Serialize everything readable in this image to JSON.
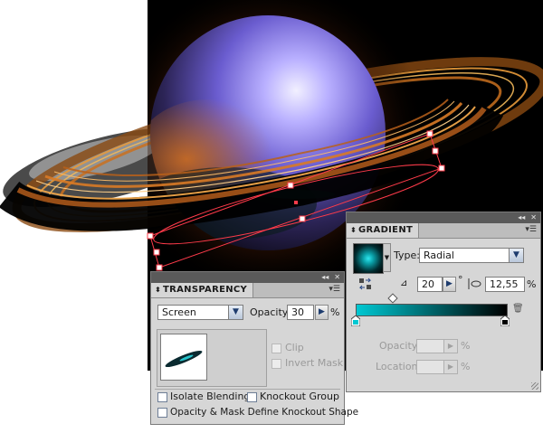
{
  "transparency": {
    "tab_label": "TRANSPARENCY",
    "blend_mode": "Screen",
    "opacity_label": "Opacity:",
    "opacity_value": "30",
    "opacity_unit": "%",
    "clip_label": "Clip",
    "invert_mask_label": "Invert Mask",
    "isolate_blending_label": "Isolate Blending",
    "knockout_group_label": "Knockout Group",
    "opacity_mask_knockout_label": "Opacity & Mask Define Knockout Shape",
    "dropdown_glyph": "▼",
    "arrow_glyph": "▶",
    "menu_glyph": "▾☰",
    "collapse_glyph": "◂◂",
    "close_glyph": "✕",
    "tab_marker": "⬍"
  },
  "gradient": {
    "tab_label": "GRADIENT",
    "type_label": "Type:",
    "type_value": "Radial",
    "angle_value": "20",
    "angle_unit": "°",
    "aspect_value": "12,55",
    "aspect_unit": "%",
    "opacity_label": "Opacity:",
    "opacity_unit": "%",
    "location_label": "Location:",
    "location_unit": "%",
    "stop_colors": [
      "#00c8d2",
      "#000000"
    ],
    "dropdown_glyph": "▼",
    "arrow_glyph": "▶",
    "menu_glyph": "▾☰",
    "collapse_glyph": "◂◂",
    "close_glyph": "✕",
    "tab_marker": "⬍",
    "trash_glyph": "🗑",
    "angle_glyph": "⊿"
  },
  "colors": {
    "canvas_bg": "#000000",
    "planet_highlight": "#d9d6ff",
    "planet_body": "#7a6bd8",
    "ring_orange": "#e08a2a",
    "selection": "#ff3b4a"
  }
}
